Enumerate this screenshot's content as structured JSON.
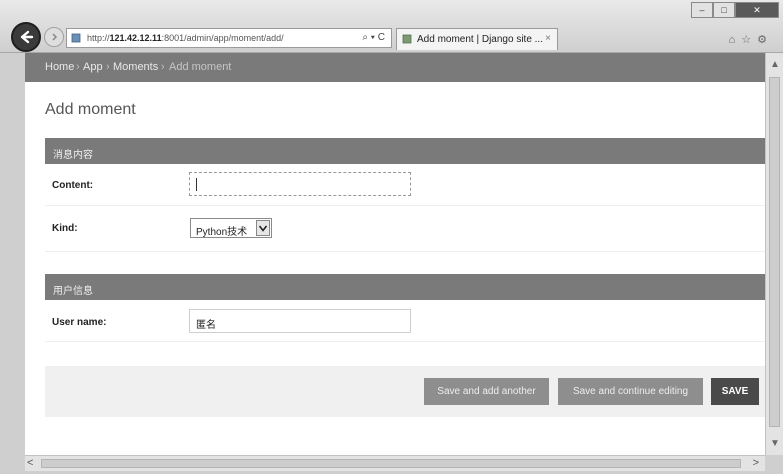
{
  "browser": {
    "url_prefix": "http://",
    "url_host": "121.42.12.11",
    "url_rest": ":8001/admin/app/moment/add/",
    "address_tools": "⌕ ▾ C",
    "tab_title": "Add moment | Django site ...",
    "tab_close": "×",
    "window_buttons": {
      "minimize": "–",
      "maximize": "□",
      "close": "✕"
    },
    "right_icons": "⌂☆⚙"
  },
  "breadcrumbs": {
    "items": [
      "Home",
      "App",
      "Moments",
      "Add moment"
    ],
    "separator": "›"
  },
  "page_title": "Add moment",
  "sections": [
    {
      "title": "消息内容",
      "fields": [
        {
          "label": "Content:",
          "value": ""
        },
        {
          "label": "Kind:",
          "value": "Python技术"
        }
      ]
    },
    {
      "title": "用户信息",
      "fields": [
        {
          "label": "User name:",
          "value": "匿名"
        }
      ]
    }
  ],
  "buttons": {
    "save_add_another": "Save and add another",
    "save_continue": "Save and continue editing",
    "save": "SAVE"
  },
  "scroll": {
    "up": "▲",
    "down": "▼",
    "left": "<",
    "right": ">"
  },
  "colors": {
    "header_bar": "#7a7a7a",
    "save_button": "#4a4a4a",
    "secondary_button": "#8e8e8e"
  }
}
